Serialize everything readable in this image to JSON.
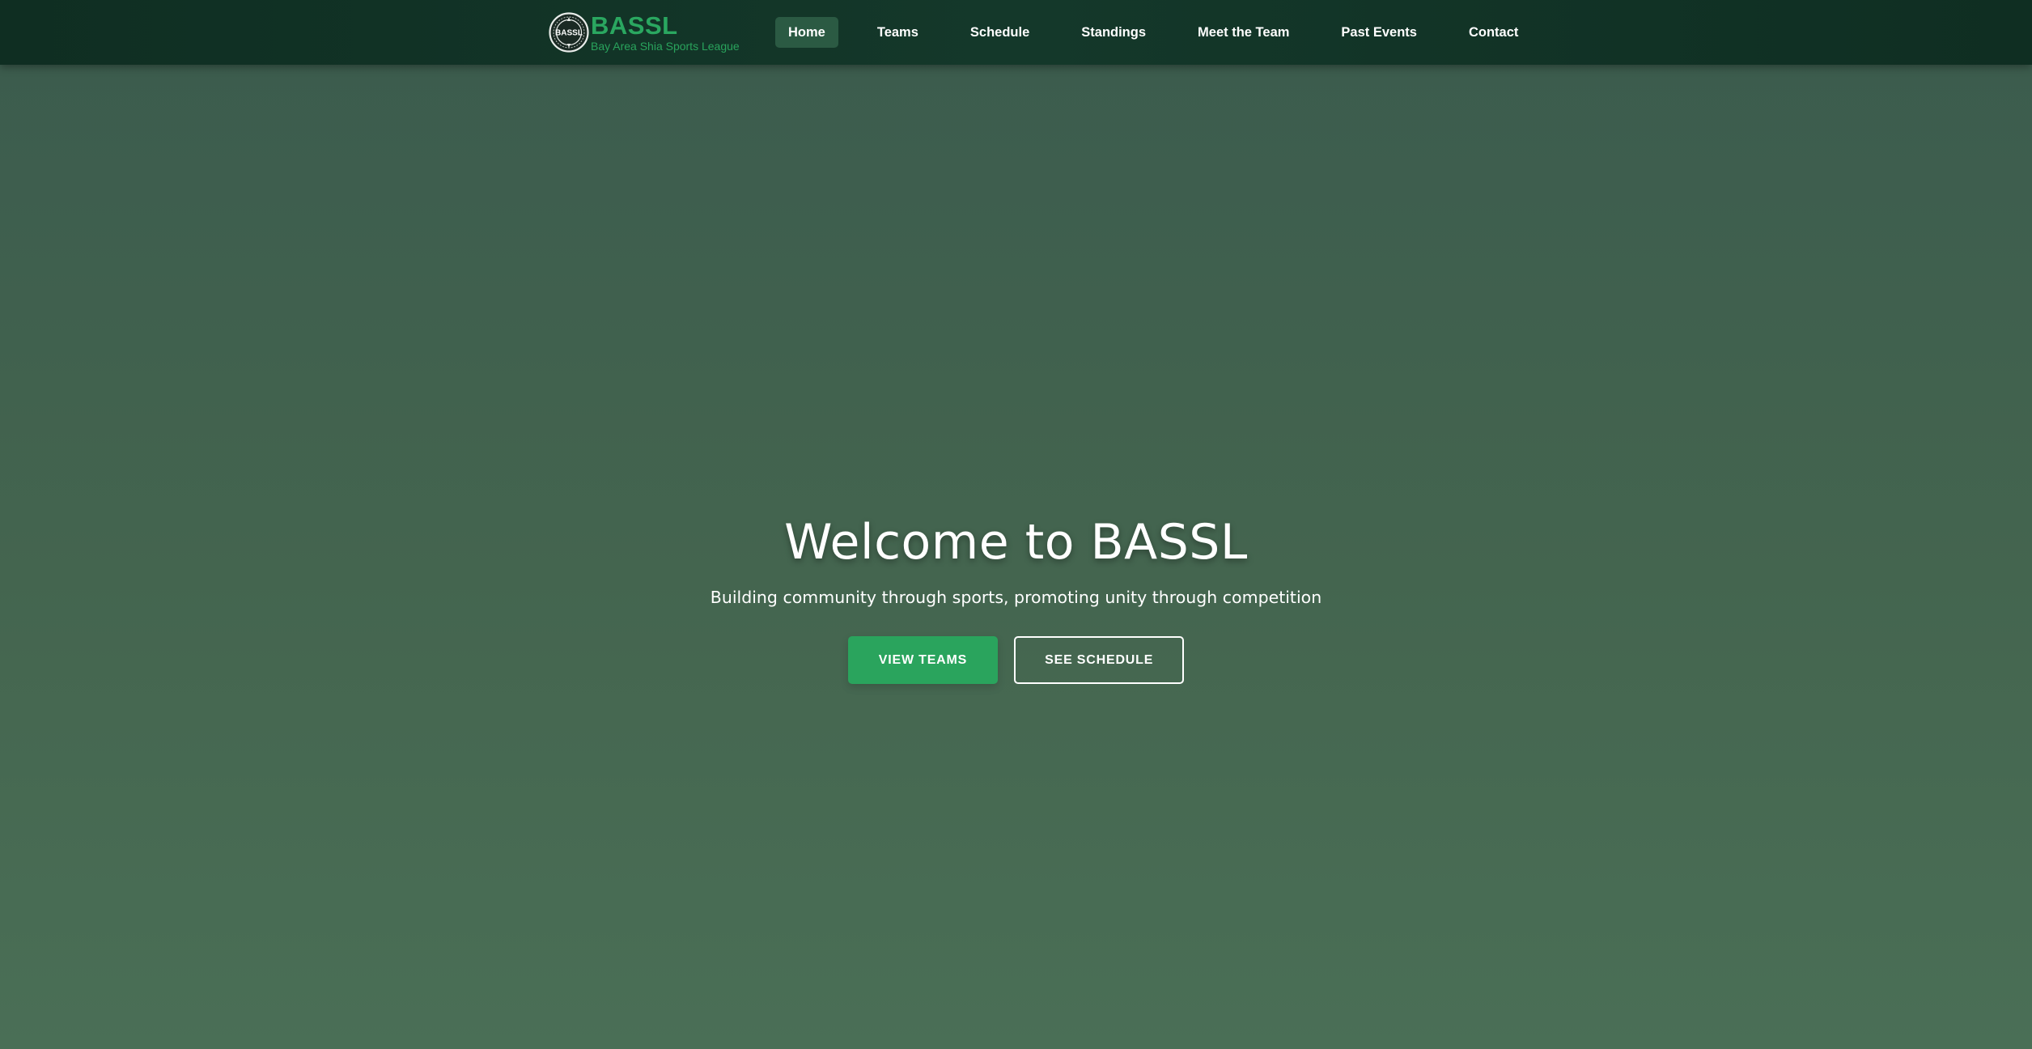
{
  "brand": {
    "logo_text": "BASSL",
    "title": "BASSL",
    "subtitle": "Bay Area Shia Sports League"
  },
  "nav": {
    "items": [
      {
        "label": "Home",
        "active": true
      },
      {
        "label": "Teams",
        "active": false
      },
      {
        "label": "Schedule",
        "active": false
      },
      {
        "label": "Standings",
        "active": false
      },
      {
        "label": "Meet the Team",
        "active": false
      },
      {
        "label": "Past Events",
        "active": false
      },
      {
        "label": "Contact",
        "active": false
      }
    ]
  },
  "hero": {
    "title": "Welcome to BASSL",
    "subtitle": "Building community through sports, promoting unity through competition",
    "primary_button": "View Teams",
    "secondary_button": "See Schedule"
  },
  "colors": {
    "header_bg": "#12342a",
    "brand_green": "#2aa760",
    "nav_active_bg": "#2b5a43",
    "hero_bg_top": "#3b5b4d",
    "hero_bg_bottom": "#4a6f56",
    "primary_button": "#2aa45d",
    "text_light": "#ffffff"
  },
  "icons": {
    "logo": "bassl-emblem-icon"
  }
}
